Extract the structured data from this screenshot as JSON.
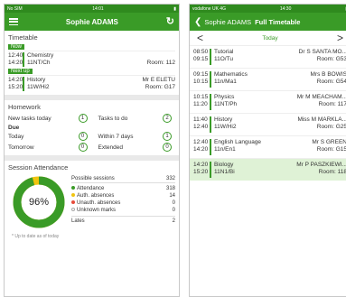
{
  "left": {
    "status": {
      "left": "No SIM",
      "center": "14:01",
      "right": "▮"
    },
    "header": {
      "title": "Sophie ADAMS"
    },
    "timetable": {
      "title": "Timetable",
      "now_label": "Now",
      "now": {
        "start": "12:40",
        "end": "14:20",
        "subject": "Chemistry",
        "group": "11NT/Ch",
        "teacher": "",
        "room": "Room: 112"
      },
      "next_label": "Next up",
      "next": {
        "start": "14:20",
        "end": "15:20",
        "subject": "History",
        "group": "11W/Hi2",
        "teacher": "Mr E ELETU",
        "room": "Room: G17"
      }
    },
    "homework": {
      "title": "Homework",
      "new_tasks_label": "New tasks today",
      "new_tasks": "1",
      "to_do_label": "Tasks to do",
      "to_do": "2",
      "due_label": "Due",
      "today_label": "Today",
      "today": "0",
      "within7_label": "Within 7 days",
      "within7": "1",
      "tomorrow_label": "Tomorrow",
      "tomorrow": "0",
      "extended_label": "Extended",
      "extended": "0"
    },
    "attendance": {
      "title": "Session Attendance",
      "percent": "96%",
      "possible_label": "Possible sessions",
      "possible": "332",
      "rows": [
        {
          "label": "Attendance",
          "value": "318",
          "color": "#3a9b27"
        },
        {
          "label": "Auth. absences",
          "value": "14",
          "color": "#f1c40f"
        },
        {
          "label": "Unauth. absences",
          "value": "0",
          "color": "#e74c3c"
        },
        {
          "label": "Unknown marks",
          "value": "0",
          "color": "#ffffff"
        }
      ],
      "lates_label": "Lates",
      "lates": "2",
      "footer": "* Up to date as of today"
    }
  },
  "right": {
    "status": {
      "left": "vodafone UK 4G",
      "center": "14:30",
      "right": "▮"
    },
    "header": {
      "back": "Sophie ADAMS",
      "title": "Full Timetable"
    },
    "day": {
      "label": "Today",
      "prev": "<",
      "next": ">"
    },
    "lessons": [
      {
        "start": "08:50",
        "end": "09:15",
        "subject": "Tutorial",
        "group": "11O/Tu",
        "teacher": "Dr S SANTA MO...",
        "room": "Room: G53"
      },
      {
        "start": "09:15",
        "end": "10:15",
        "subject": "Mathematics",
        "group": "11n/Ma1",
        "teacher": "Mrs B BOWIS",
        "room": "Room: G54"
      },
      {
        "start": "10:15",
        "end": "11:20",
        "subject": "Physics",
        "group": "11NT/Ph",
        "teacher": "Mr M MEACHAM...",
        "room": "Room: 117"
      },
      {
        "start": "11:40",
        "end": "12:40",
        "subject": "History",
        "group": "11W/Hi2",
        "teacher": "Miss M MARKLA...",
        "room": "Room: G25"
      },
      {
        "start": "12:40",
        "end": "14:20",
        "subject": "English Language",
        "group": "11n/En1",
        "teacher": "Mr S GREEN",
        "room": "Room: G15"
      },
      {
        "start": "14:20",
        "end": "15:20",
        "subject": "Biology",
        "group": "11N1/Bi",
        "teacher": "Mr P PASZKIEWI...",
        "room": "Room: 118"
      }
    ]
  }
}
